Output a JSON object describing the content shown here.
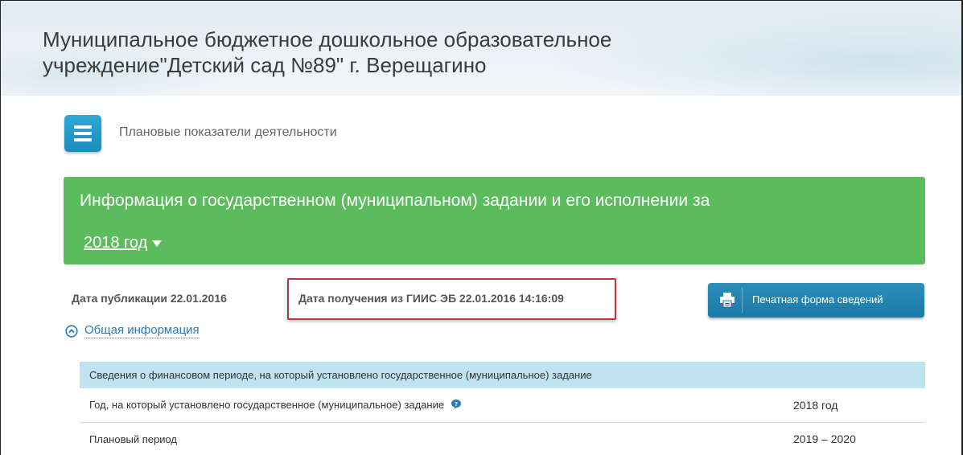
{
  "header": {
    "org_title_line1": "Муниципальное бюджетное дошкольное образовательное",
    "org_title_line2": "учреждение\"Детский сад №89\" г. Верещагино"
  },
  "nav": {
    "menu_icon": "hamburger-menu-icon",
    "breadcrumb": "Плановые показатели деятельности"
  },
  "banner": {
    "title": "Информация о государственном (муниципальном) задании и его исполнении за",
    "selected_year": "2018 год",
    "background_color": "#5cbb5c"
  },
  "meta": {
    "publication_date": "Дата публикации 22.01.2016",
    "received_date": "Дата получения из ГИИС ЭБ 22.01.2016 14:16:09",
    "highlight_color": "#b5383b"
  },
  "print_button": {
    "icon": "printer-icon",
    "label": "Печатная форма сведений",
    "color": "#1b7aa6"
  },
  "section": {
    "icon": "chevron-up-circle-icon",
    "label": "Общая информация"
  },
  "table": {
    "header": "Сведения о финансовом периоде, на который установлено государственное (муниципальное) задание",
    "header_color": "#bfe3ef",
    "rows": [
      {
        "label": "Год, на который установлено государственное (муниципальное) задание",
        "value": "2018 год",
        "icon": "help-icon"
      },
      {
        "label": "Плановый период",
        "value": "2019 – 2020"
      }
    ]
  }
}
